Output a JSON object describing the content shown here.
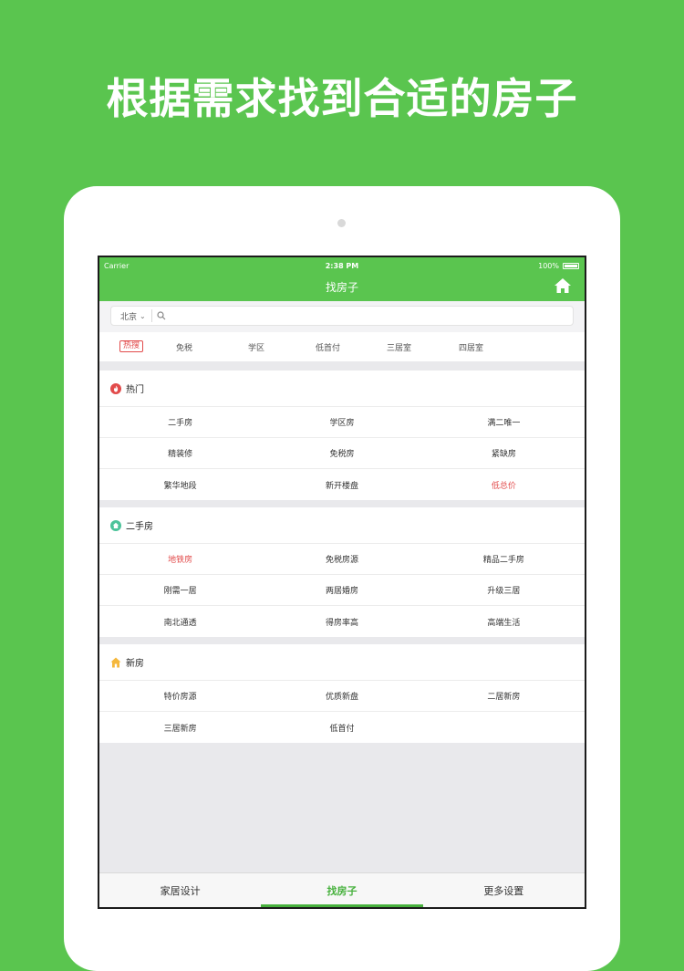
{
  "promo": {
    "title": "根据需求找到合适的房子"
  },
  "status": {
    "carrier": "Carrier",
    "time": "2:38 PM",
    "battery": "100%"
  },
  "nav": {
    "title": "找房子"
  },
  "search": {
    "city": "北京",
    "placeholder": ""
  },
  "filters": {
    "hot_tag": "热搜",
    "items": [
      "免税",
      "学区",
      "低首付",
      "三居室",
      "四居室"
    ]
  },
  "sections": [
    {
      "title": "热门",
      "icon": "fire-icon",
      "rows": [
        [
          {
            "label": "二手房"
          },
          {
            "label": "学区房"
          },
          {
            "label": "满二唯一"
          }
        ],
        [
          {
            "label": "精装修"
          },
          {
            "label": "免税房"
          },
          {
            "label": "紧缺房"
          }
        ],
        [
          {
            "label": "繁华地段"
          },
          {
            "label": "新开楼盘"
          },
          {
            "label": "低总价"
          }
        ]
      ]
    },
    {
      "title": "二手房",
      "icon": "house-circle-icon",
      "rows": [
        [
          {
            "label": "地铁房"
          },
          {
            "label": "免税房源"
          },
          {
            "label": "精品二手房"
          }
        ],
        [
          {
            "label": "刚需一居"
          },
          {
            "label": "两居婚房"
          },
          {
            "label": "升级三居"
          }
        ],
        [
          {
            "label": "南北通透"
          },
          {
            "label": "得房率高"
          },
          {
            "label": "高端生活"
          }
        ]
      ]
    },
    {
      "title": "新房",
      "icon": "new-house-icon",
      "rows": [
        [
          {
            "label": "特价房源"
          },
          {
            "label": "优质新盘"
          },
          {
            "label": "二居新房"
          }
        ],
        [
          {
            "label": "三居新房"
          },
          {
            "label": "低首付"
          },
          {
            "label": ""
          }
        ]
      ]
    }
  ],
  "tabs": [
    "家居设计",
    "找房子",
    "更多设置"
  ],
  "colors": {
    "brand_green": "#5ac54f",
    "accent_red": "#e24b4b"
  }
}
